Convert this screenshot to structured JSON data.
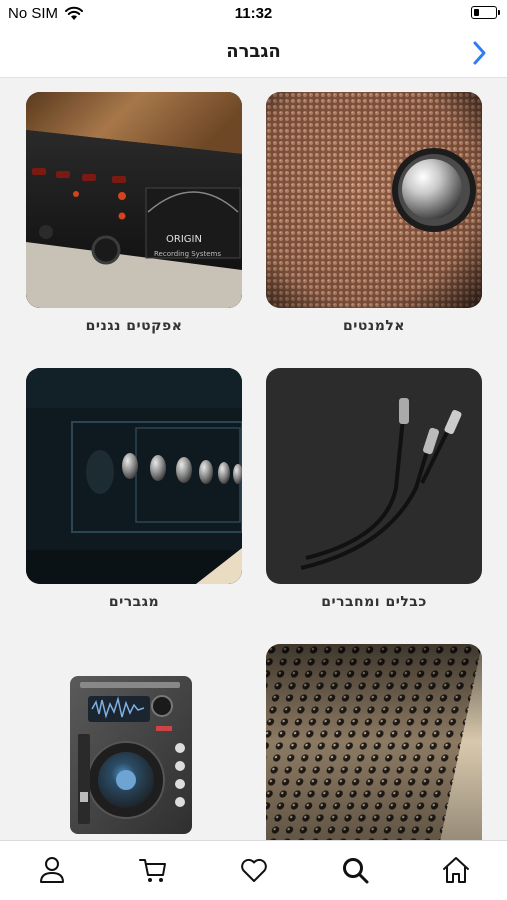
{
  "status_bar": {
    "carrier": "No SIM",
    "time": "11:32"
  },
  "header": {
    "title": "הגברה",
    "back_icon": "chevron-right-icon"
  },
  "categories": [
    {
      "label": "אלמנטים",
      "image": "speaker-driver"
    },
    {
      "label": "אפקטים נגנים",
      "image": "recording-rack"
    },
    {
      "label": "כבלים ומחברים",
      "image": "xlr-cables"
    },
    {
      "label": "מגברים",
      "image": "amplifier-knobs"
    },
    {
      "label": "",
      "image": "mixing-console"
    },
    {
      "label": "",
      "image": "dj-cd-player"
    }
  ],
  "tab_bar": {
    "items": [
      {
        "icon": "home-icon"
      },
      {
        "icon": "search-icon"
      },
      {
        "icon": "heart-icon"
      },
      {
        "icon": "cart-icon"
      },
      {
        "icon": "user-icon"
      }
    ]
  },
  "colors": {
    "accent": "#2f7cf6",
    "background": "#f2f2f2"
  }
}
